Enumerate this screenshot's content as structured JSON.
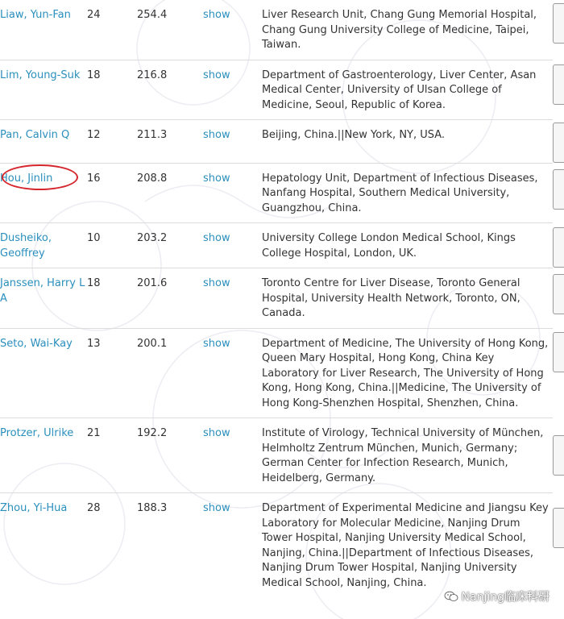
{
  "table": {
    "rows": [
      {
        "name": "Liaw, Yun-Fan",
        "count": "24",
        "score": "254.4",
        "show": "show",
        "affiliation": "Liver Research Unit, Chang Gung Memorial Hospital, Chang Gung University College of Medicine, Taipei, Taiwan."
      },
      {
        "name": "Lim, Young-Suk",
        "count": "18",
        "score": "216.8",
        "show": "show",
        "affiliation": "Department of Gastroenterology, Liver Center, Asan Medical Center, University of Ulsan College of Medicine, Seoul, Republic of Korea."
      },
      {
        "name": "Pan, Calvin Q",
        "count": "12",
        "score": "211.3",
        "show": "show",
        "affiliation": "Beijing, China.||New York, NY, USA."
      },
      {
        "name": "Hou, Jinlin",
        "count": "16",
        "score": "208.8",
        "show": "show",
        "affiliation": "Hepatology Unit, Department of Infectious Diseases, Nanfang Hospital, Southern Medical University, Guangzhou, China."
      },
      {
        "name": "Dusheiko, Geoffrey",
        "count": "10",
        "score": "203.2",
        "show": "show",
        "affiliation": "University College London Medical School, Kings College Hospital, London, UK."
      },
      {
        "name": "Janssen, Harry L A",
        "count": "18",
        "score": "201.6",
        "show": "show",
        "affiliation": "Toronto Centre for Liver Disease, Toronto General Hospital, University Health Network, Toronto, ON, Canada."
      },
      {
        "name": "Seto, Wai-Kay",
        "count": "13",
        "score": "200.1",
        "show": "show",
        "affiliation": "Department of Medicine, The University of Hong Kong, Queen Mary Hospital, Hong Kong, China Key Laboratory for Liver Research, The University of Hong Kong, Hong Kong, China.||Medicine, The University of Hong Kong-Shenzhen Hospital, Shenzhen, China."
      },
      {
        "name": "Protzer, Ulrike",
        "count": "21",
        "score": "192.2",
        "show": "show",
        "affiliation": "Institute of Virology, Technical University of München, Helmholtz Zentrum München, Munich, Germany; German Center for Infection Research, Munich, Heidelberg, Germany."
      },
      {
        "name": "Zhou, Yi-Hua",
        "count": "28",
        "score": "188.3",
        "show": "show",
        "affiliation": "Department of Experimental Medicine and Jiangsu Key Laboratory for Molecular Medicine, Nanjing Drum Tower Hospital, Nanjing University Medical School, Nanjing, China.||Department of Infectious Diseases, Nanjing Drum Tower Hospital, Nanjing University Medical School, Nanjing, China."
      }
    ]
  },
  "watermark": {
    "text": "Nanjing临床科研",
    "icon": "wechat-icon"
  },
  "colors": {
    "link": "#2a8fbd",
    "highlight": "#d6262d",
    "border": "#dcdcdc"
  }
}
